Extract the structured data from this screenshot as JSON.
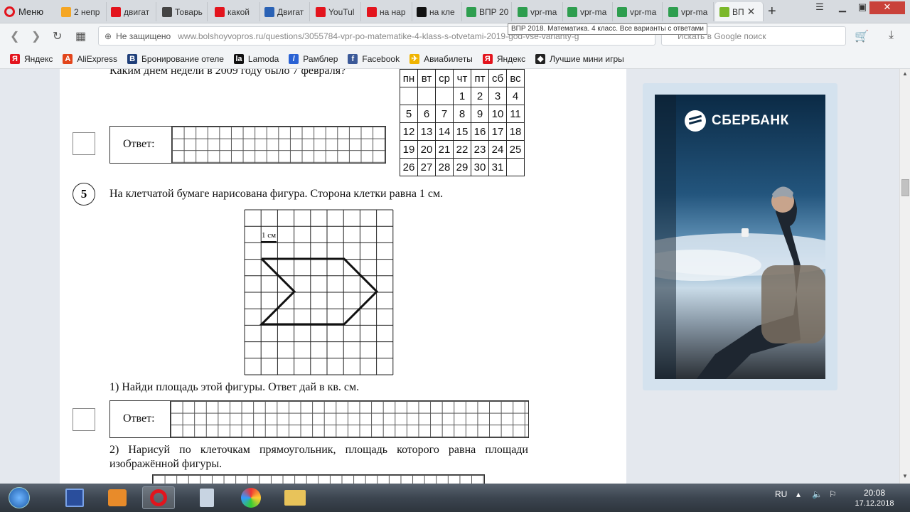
{
  "browser": {
    "menu_label": "Меню",
    "tabs": [
      {
        "label": "2 непр",
        "fav": "mail-icon",
        "color": "#f5a623"
      },
      {
        "label": "двигат",
        "fav": "yandex-icon",
        "color": "#e3141d"
      },
      {
        "label": "Товарь",
        "fav": "car-icon",
        "color": "#444444"
      },
      {
        "label": "какой",
        "fav": "yandex-icon",
        "color": "#e3141d"
      },
      {
        "label": "Двигат",
        "fav": "doc-icon",
        "color": "#2a62b5"
      },
      {
        "label": "YouTul",
        "fav": "youtube-icon",
        "color": "#e3141d"
      },
      {
        "label": "на нар",
        "fav": "yandex-icon",
        "color": "#e3141d"
      },
      {
        "label": "на кле",
        "fav": "z-icon",
        "color": "#111111"
      },
      {
        "label": "ВПР 20",
        "fav": "ege-icon",
        "color": "#2e9e4f"
      },
      {
        "label": "vpr-ma",
        "fav": "ege-icon",
        "color": "#2e9e4f"
      },
      {
        "label": "vpr-ma",
        "fav": "ege-icon",
        "color": "#2e9e4f"
      },
      {
        "label": "vpr-ma",
        "fav": "ege-icon",
        "color": "#2e9e4f"
      },
      {
        "label": "vpr-ma",
        "fav": "ege-icon",
        "color": "#2e9e4f"
      },
      {
        "label": "ВП",
        "fav": "question-icon",
        "color": "#7bb82a",
        "active": true
      }
    ],
    "tooltip": "ВПР 2018. Математика. 4 класс. Все варианты с ответами",
    "address": {
      "not_secure": "Не защищено",
      "url": "www.bolshoyvopros.ru/questions/3055784-vpr-po-matematike-4-klass-s-otvetami-2019-god-vse-varianty-g"
    },
    "search_placeholder": "Искать в Google поиск",
    "bookmarks": [
      {
        "label": "Яндекс",
        "icon": "yandex-icon",
        "color": "#e3141d",
        "glyph": "Я"
      },
      {
        "label": "AliExpress",
        "icon": "aliexpress-icon",
        "color": "#e2451b",
        "glyph": "A"
      },
      {
        "label": "Бронирование отеле",
        "icon": "booking-icon",
        "color": "#1f3f7a",
        "glyph": "B"
      },
      {
        "label": "Lamoda",
        "icon": "lamoda-icon",
        "color": "#111111",
        "glyph": "la"
      },
      {
        "label": "Рамблер",
        "icon": "rambler-icon",
        "color": "#2a62d4",
        "glyph": "/"
      },
      {
        "label": "Facebook",
        "icon": "facebook-icon",
        "color": "#3b5998",
        "glyph": "f"
      },
      {
        "label": "Авиабилеты",
        "icon": "plane-icon",
        "color": "#f0b400",
        "glyph": "✈"
      },
      {
        "label": "Яндекс",
        "icon": "yandex-icon",
        "color": "#e3141d",
        "glyph": "Я"
      },
      {
        "label": "Лучшие мини игры",
        "icon": "cube-icon",
        "color": "#222222",
        "glyph": "◆"
      }
    ]
  },
  "document": {
    "q4_text": "Каким днем недели в 2009 году было 7 февраля?",
    "answer_label": "Ответ:",
    "calendar": {
      "headers": [
        "пн",
        "вт",
        "ср",
        "чт",
        "пт",
        "сб",
        "вс"
      ],
      "rows": [
        [
          "",
          "",
          "",
          "1",
          "2",
          "3",
          "4"
        ],
        [
          "5",
          "6",
          "7",
          "8",
          "9",
          "10",
          "11"
        ],
        [
          "12",
          "13",
          "14",
          "15",
          "16",
          "17",
          "18"
        ],
        [
          "19",
          "20",
          "21",
          "22",
          "23",
          "24",
          "25"
        ],
        [
          "26",
          "27",
          "28",
          "29",
          "30",
          "31",
          ""
        ]
      ]
    },
    "q5_number": "5",
    "q5_text": "На клетчатой бумаге нарисована фигура. Сторона клетки равна 1 см.",
    "scale_label": "1 см",
    "q5_part1": "1) Найди площадь этой фигуры. Ответ дай в кв. см.",
    "q5_part2": "2) Нарисуй по клеточкам прямоугольник, площадь которого равна площади изображённой фигуры."
  },
  "ad": {
    "brand": "СБЕРБАНК"
  },
  "taskbar": {
    "lang": "RU",
    "time": "20:08",
    "date": "17.12.2018"
  }
}
